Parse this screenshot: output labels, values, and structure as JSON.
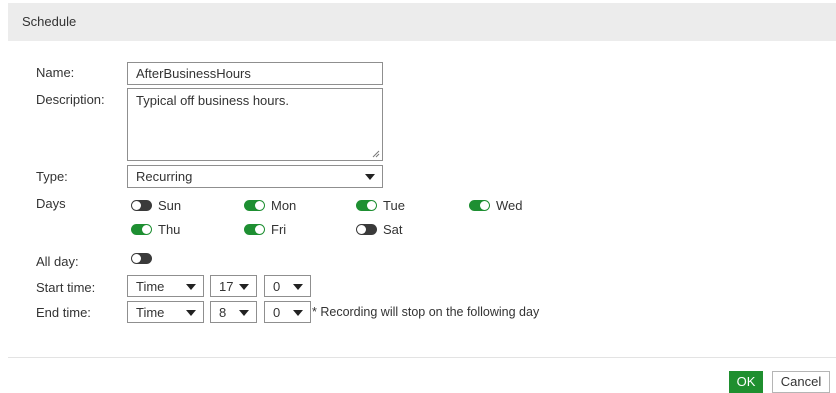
{
  "dialog": {
    "title": "Schedule"
  },
  "form": {
    "name_label": "Name:",
    "name_value": "AfterBusinessHours",
    "description_label": "Description:",
    "description_value": "Typical off business hours.",
    "type_label": "Type:",
    "type_value": "Recurring",
    "days_label": "Days",
    "days": [
      {
        "label": "Sun",
        "enabled": false
      },
      {
        "label": "Mon",
        "enabled": true
      },
      {
        "label": "Tue",
        "enabled": true
      },
      {
        "label": "Wed",
        "enabled": true
      },
      {
        "label": "Thu",
        "enabled": true
      },
      {
        "label": "Fri",
        "enabled": true
      },
      {
        "label": "Sat",
        "enabled": false
      }
    ],
    "all_day_label": "All day:",
    "all_day_enabled": false,
    "start_time_label": "Start time:",
    "start_time": {
      "mode": "Time",
      "hour": "17",
      "minute": "0"
    },
    "end_time_label": "End time:",
    "end_time": {
      "mode": "Time",
      "hour": "8",
      "minute": "0"
    },
    "end_time_note": "* Recording will stop on the following day"
  },
  "footer": {
    "ok_label": "OK",
    "cancel_label": "Cancel"
  },
  "colors": {
    "toggle_on": "#1e8f32",
    "toggle_off": "#3a3a3a",
    "ok_button": "#1f8f2f",
    "header_bg": "#ececec"
  }
}
